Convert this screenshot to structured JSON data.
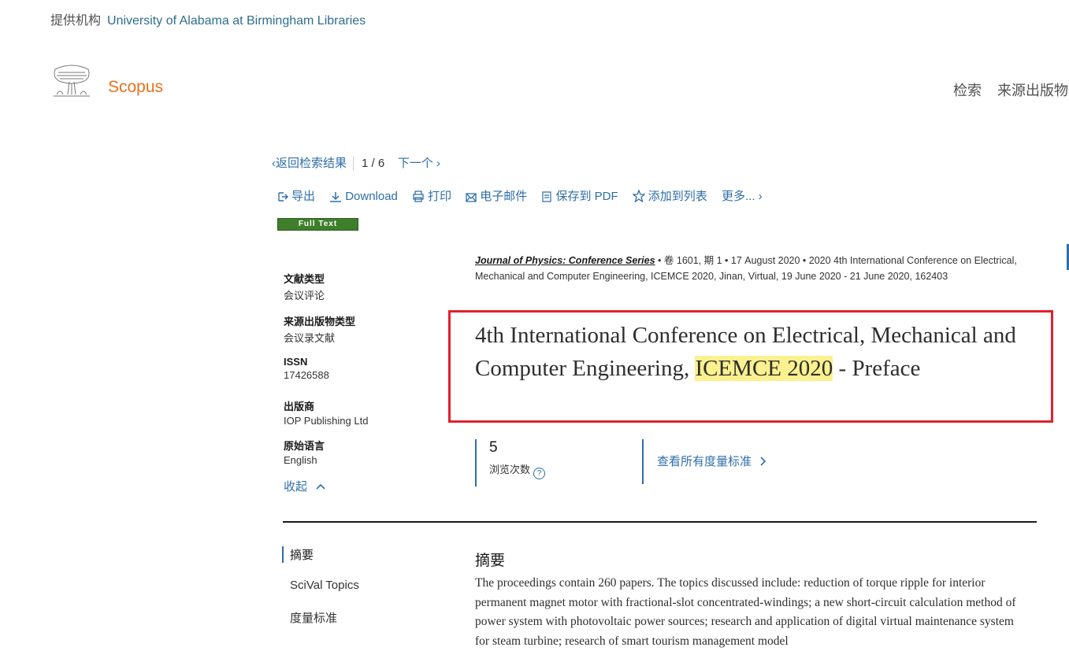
{
  "provider": {
    "label": "提供机构",
    "institution": "University of Alabama at Birmingham Libraries"
  },
  "brand": {
    "name": "Scopus"
  },
  "topnav": {
    "search": "检索",
    "sources": "来源出版物"
  },
  "resultnav": {
    "back": "返回检索结果",
    "position": "1 / 6",
    "next": "下一个"
  },
  "toolbar": {
    "export": "导出",
    "download": "Download",
    "print": "打印",
    "email": "电子邮件",
    "save_pdf": "保存到 PDF",
    "add_list": "添加到列表",
    "more": "更多..."
  },
  "fulltext_badge": "Full Text",
  "metadata": {
    "doc_type_key": "文献类型",
    "doc_type_val": "会议评论",
    "source_type_key": "来源出版物类型",
    "source_type_val": "会议录文献",
    "issn_key": "ISSN",
    "issn_val": "17426588",
    "publisher_key": "出版商",
    "publisher_val": "IOP Publishing Ltd",
    "language_key": "原始语言",
    "language_val": "English",
    "collapse": "收起"
  },
  "source": {
    "journal": "Journal of Physics: Conference Series",
    "details": "• 卷 1601, 期 1 • 17 August 2020 • 2020 4th International Conference on Electrical, Mechanical and Computer Engineering, ICEMCE 2020, Jinan, Virtual, 19 June 2020 - 21 June 2020, 162403"
  },
  "title": {
    "part1": "4th International Conference on Electrical, Mechanical and Computer Engineering,",
    "highlight": "ICEMCE 2020",
    "part2": "- Preface"
  },
  "metrics": {
    "views": "5",
    "views_label": "浏览次数",
    "all_metrics": "查看所有度量标准"
  },
  "sidenav": {
    "abstract": "摘要",
    "scival": "SciVal Topics",
    "metrics": "度量标准"
  },
  "abstract": {
    "heading": "摘要",
    "text": "The proceedings contain 260 papers. The topics discussed include: reduction of torque ripple for interior permanent magnet motor with fractional-slot concentrated-windings; a new short-circuit calculation method of power system with photovoltaic power sources; research and application of digital virtual maintenance system for steam turbine; research of smart tourism management model"
  },
  "colors": {
    "accent": "#2e6ea8",
    "brand": "#e9711c",
    "highlight": "#fbf18f",
    "annotation_box": "#e0212e"
  }
}
